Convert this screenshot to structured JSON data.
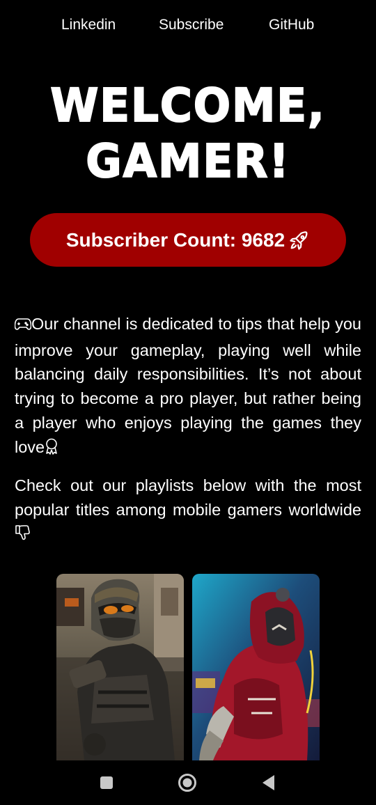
{
  "nav": {
    "links": [
      "Linkedin",
      "Subscribe",
      "GitHub"
    ]
  },
  "hero": {
    "title_line1": "WELCOME,",
    "title_line2": "GAMER!"
  },
  "subscriber": {
    "label": "Subscriber Count: 9682",
    "icon": "rocket-icon"
  },
  "description": {
    "paragraph1": "Our channel is dedicated to tips that help you improve your gameplay, playing well while balancing daily responsibilities. It’s not about trying to become a pro player, but rather being a player who enjoys playing the games they love",
    "paragraph1_icon_start": "gamepad-icon",
    "paragraph1_icon_end": "award-icon",
    "paragraph2": "Check out our playlists below with the most popular titles among mobile gamers worldwide",
    "paragraph2_icon_end": "thumbs-down-icon"
  },
  "playlists": [
    {
      "image": "soldier-game-art"
    },
    {
      "image": "red-hooded-hero-game-art"
    }
  ],
  "system_nav": {
    "icons": [
      "recent-apps-icon",
      "home-icon",
      "back-icon"
    ]
  },
  "colors": {
    "background": "#000000",
    "accent": "#a00000",
    "text": "#ffffff"
  }
}
